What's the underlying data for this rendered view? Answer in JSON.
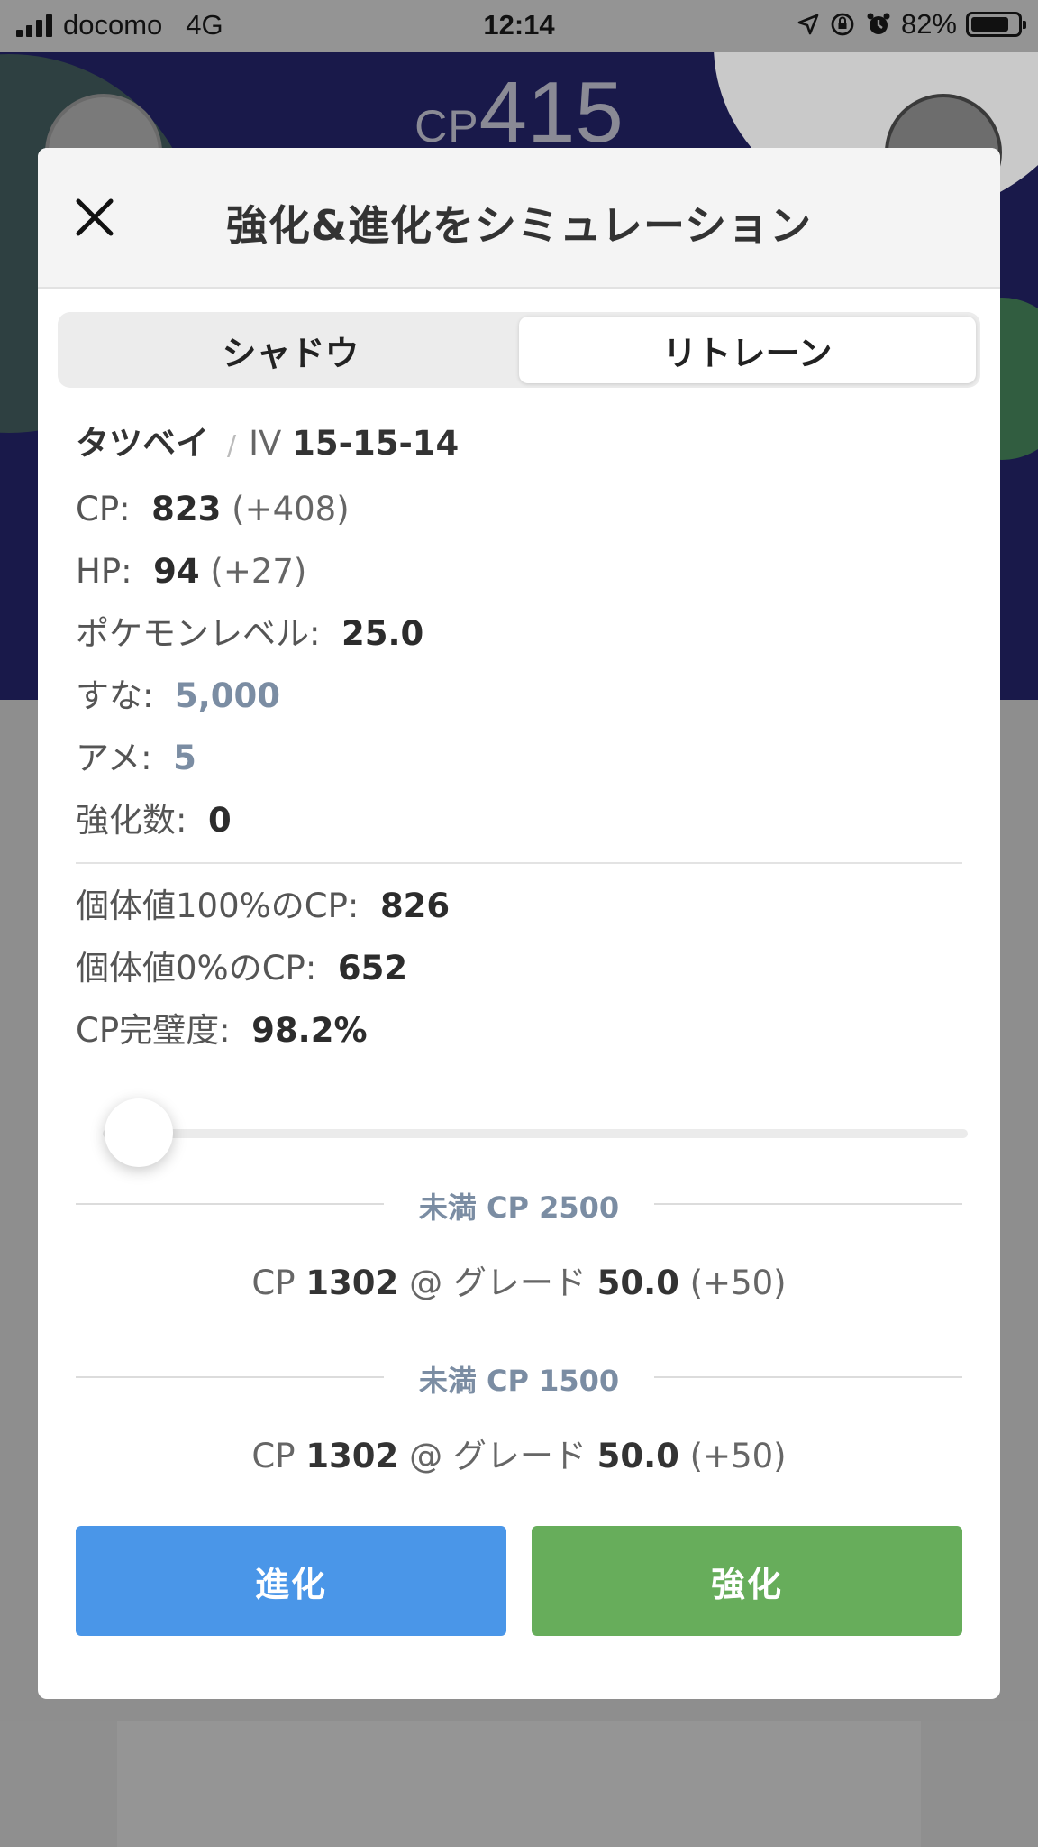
{
  "status_bar": {
    "carrier": "docomo",
    "network": "4G",
    "time": "12:14",
    "battery": "82%",
    "battery_level": 0.82
  },
  "background": {
    "cp_prefix": "CP",
    "cp_value": "415"
  },
  "modal": {
    "title": "強化&進化をシミュレーション",
    "close_icon": "close-icon"
  },
  "segment": {
    "tabs": [
      {
        "label": "シャドウ",
        "active": false
      },
      {
        "label": "リトレーン",
        "active": true
      }
    ]
  },
  "pokemon": {
    "name": "タツベイ",
    "iv_label": "IV",
    "iv_value": "15-15-14"
  },
  "stats": {
    "cp_label": "CP:",
    "cp_value": "823",
    "cp_delta": "(+408)",
    "hp_label": "HP:",
    "hp_value": "94",
    "hp_delta": "(+27)",
    "level_label": "ポケモンレベル:",
    "level_value": "25.0",
    "stardust_label": "すな:",
    "stardust_value": "5,000",
    "candy_label": "アメ:",
    "candy_value": "5",
    "powerups_label": "強化数:",
    "powerups_value": "0"
  },
  "perfection": {
    "max_label": "個体値100%のCP:",
    "max_value": "826",
    "min_label": "個体値0%のCP:",
    "min_value": "652",
    "pct_label": "CP完璧度:",
    "pct_value": "98.2%"
  },
  "slider": {
    "value": 0
  },
  "leagues": [
    {
      "header": "未満 CP 2500",
      "cp_label": "CP",
      "cp_value": "1302",
      "at": "@",
      "grade_label": "グレード",
      "grade_value": "50.0",
      "grade_delta": "(+50)"
    },
    {
      "header": "未満 CP 1500",
      "cp_label": "CP",
      "cp_value": "1302",
      "at": "@",
      "grade_label": "グレード",
      "grade_value": "50.0",
      "grade_delta": "(+50)"
    }
  ],
  "actions": {
    "evolve": "進化",
    "power_up": "強化"
  },
  "colors": {
    "evolve_button": "#4a96e8",
    "power_up_button": "#67ad5b",
    "muted_value": "#7b8da3"
  }
}
